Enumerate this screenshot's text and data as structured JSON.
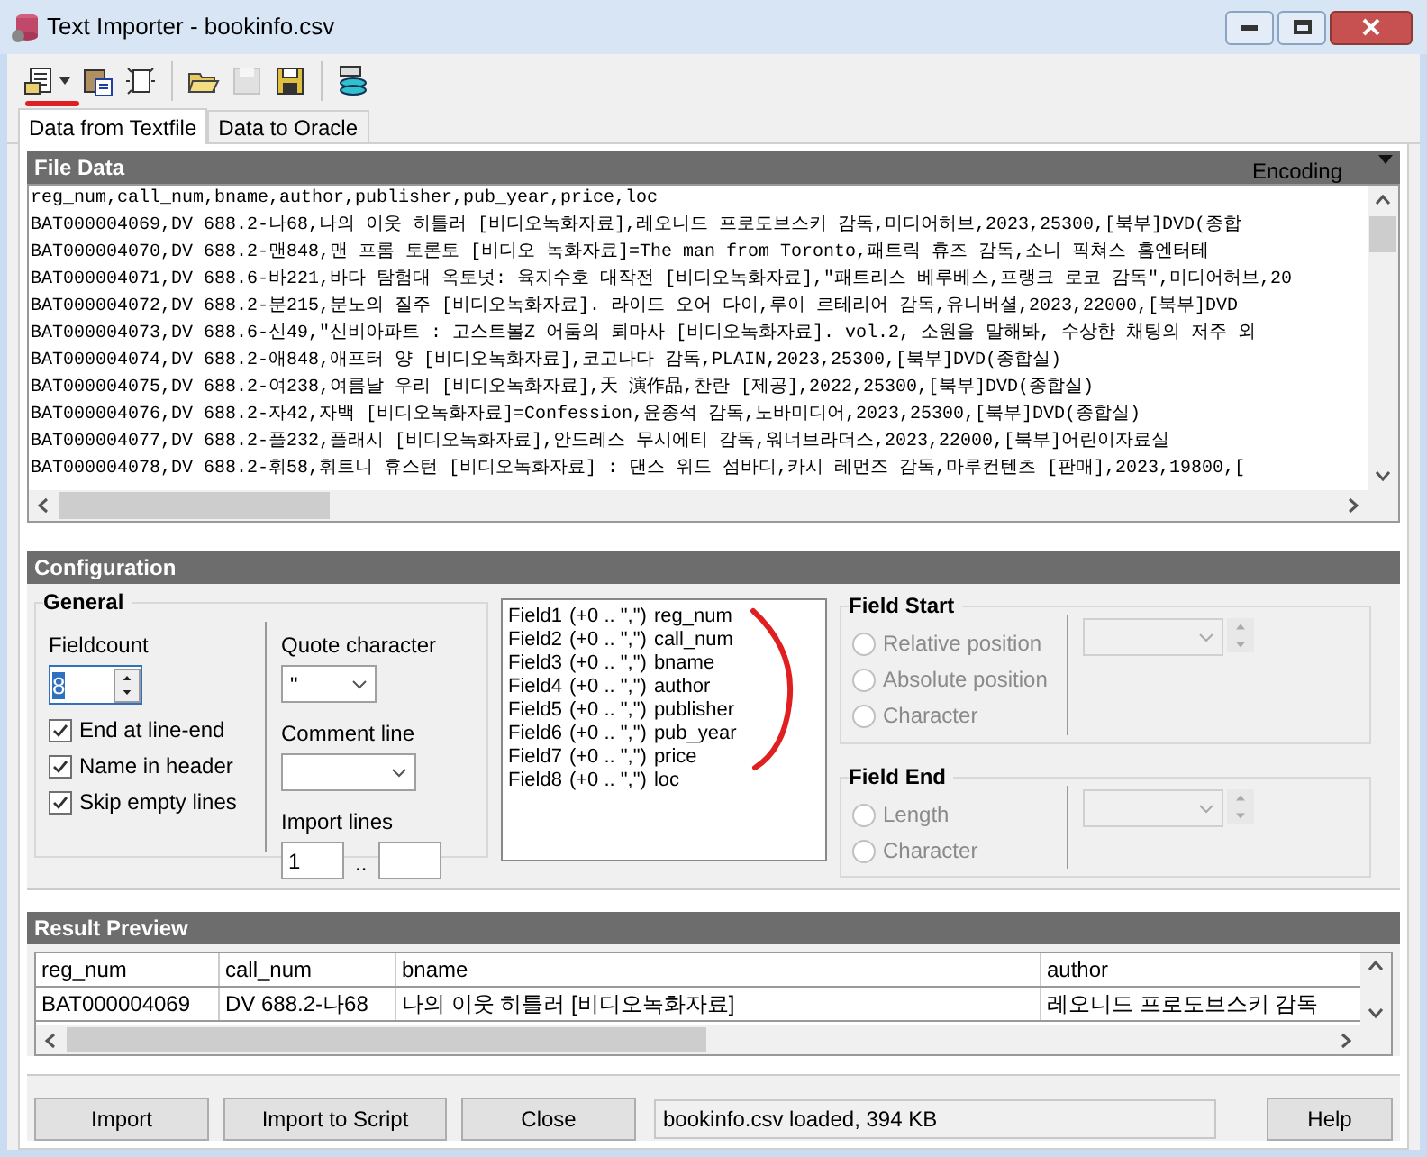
{
  "window": {
    "title": "Text Importer - bookinfo.csv"
  },
  "tabs": [
    {
      "label": "Data from Textfile",
      "selected": true
    },
    {
      "label": "Data to Oracle",
      "selected": false
    }
  ],
  "file_data": {
    "title": "File Data",
    "encoding_label": "Encoding",
    "lines": [
      "reg_num,call_num,bname,author,publisher,pub_year,price,loc",
      "BAT000004069,DV 688.2-나68,나의 이웃 히틀러 [비디오녹화자료],레오니드 프로도브스키 감독,미디어허브,2023,25300,[북부]DVD(종합",
      "BAT000004070,DV 688.2-맨848,맨 프롬 토론토 [비디오 녹화자료]=The man from Toronto,패트릭 휴즈 감독,소니 픽쳐스 홈엔터테",
      "BAT000004071,DV 688.6-바221,바다 탐험대 옥토넛: 육지수호 대작전 [비디오녹화자료],\"패트리스 베루베스,프랭크 로코 감독\",미디어허브,20",
      "BAT000004072,DV 688.2-분215,분노의 질주 [비디오녹화자료]. 라이드 오어 다이,루이 르테리어 감독,유니버셜,2023,22000,[북부]DVD",
      "BAT000004073,DV 688.6-신49,\"신비아파트 : 고스트볼Z 어둠의 퇴마사 [비디오녹화자료]. vol.2, 소원을 말해봐, 수상한 채팅의 저주 외",
      "BAT000004074,DV 688.2-애848,애프터 양 [비디오녹화자료],코고나다 감독,PLAIN,2023,25300,[북부]DVD(종합실)",
      "BAT000004075,DV 688.2-여238,여름날 우리 [비디오녹화자료],天 演作品,찬란 [제공],2022,25300,[북부]DVD(종합실)",
      "BAT000004076,DV 688.2-자42,자백 [비디오녹화자료]=Confession,윤종석 감독,노바미디어,2023,25300,[북부]DVD(종합실)",
      "BAT000004077,DV 688.2-플232,플래시 [비디오녹화자료],안드레스 무시에티 감독,워너브라더스,2023,22000,[북부]어린이자료실",
      "BAT000004078,DV 688.2-휘58,휘트니 휴스턴 [비디오녹화자료] : 댄스 위드 섬바디,카시 레먼즈 감독,마루컨텐츠 [판매],2023,19800,["
    ]
  },
  "configuration": {
    "title": "Configuration",
    "general": {
      "title": "General",
      "fieldcount_label": "Fieldcount",
      "fieldcount_value": "8",
      "checkboxes": [
        {
          "label": "End at line-end",
          "checked": true
        },
        {
          "label": "Name in header",
          "checked": true
        },
        {
          "label": "Skip empty lines",
          "checked": true
        }
      ],
      "quote_label": "Quote character",
      "quote_value": "\"",
      "comment_label": "Comment line",
      "import_lines_label": "Import lines",
      "import_from": "1",
      "range_separator": ".."
    },
    "fields": [
      {
        "name": "Field1",
        "spec": "(+0 .. \",\")",
        "column": "reg_num"
      },
      {
        "name": "Field2",
        "spec": "(+0 .. \",\")",
        "column": "call_num"
      },
      {
        "name": "Field3",
        "spec": "(+0 .. \",\")",
        "column": "bname"
      },
      {
        "name": "Field4",
        "spec": "(+0 .. \",\")",
        "column": "author"
      },
      {
        "name": "Field5",
        "spec": "(+0 .. \",\")",
        "column": "publisher"
      },
      {
        "name": "Field6",
        "spec": "(+0 .. \",\")",
        "column": "pub_year"
      },
      {
        "name": "Field7",
        "spec": "(+0 .. \",\")",
        "column": "price"
      },
      {
        "name": "Field8",
        "spec": "(+0 .. \",\")",
        "column": "loc"
      }
    ],
    "field_start": {
      "title": "Field Start",
      "disabled": true,
      "options": [
        {
          "label": "Relative position",
          "selected": false
        },
        {
          "label": "Absolute position",
          "selected": false
        },
        {
          "label": "Character",
          "selected": false
        }
      ]
    },
    "field_end": {
      "title": "Field End",
      "disabled": true,
      "options": [
        {
          "label": "Length",
          "selected": false
        },
        {
          "label": "Character",
          "selected": false
        }
      ]
    }
  },
  "result_preview": {
    "title": "Result Preview",
    "columns": [
      "reg_num",
      "call_num",
      "bname",
      "author"
    ],
    "rows": [
      [
        "BAT000004069",
        "DV 688.2-나68",
        "나의 이웃 히틀러 [비디오녹화자료]",
        "레오니드 프로도브스키 감독"
      ]
    ]
  },
  "buttons": [
    "Import",
    "Import to Script",
    "Close"
  ],
  "status": "bookinfo.csv loaded,  394 KB",
  "help_button": "Help"
}
